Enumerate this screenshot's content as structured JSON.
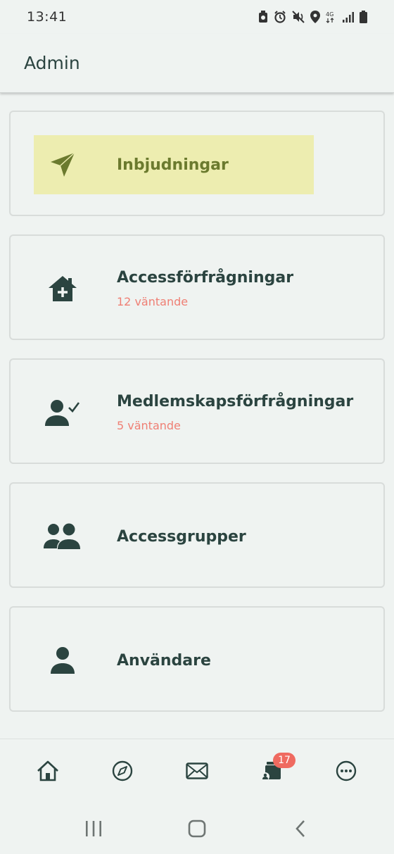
{
  "status_bar": {
    "time": "13:41",
    "network": "4G"
  },
  "app_bar": {
    "title": "Admin"
  },
  "cards": [
    {
      "title": "Inbjudningar",
      "subtitle": "",
      "icon": "send-icon",
      "highlighted": true
    },
    {
      "title": "Accessförfrågningar",
      "subtitle": "12 väntande",
      "icon": "house-plus-icon",
      "highlighted": false
    },
    {
      "title": "Medlemskapsförfrågningar",
      "subtitle": "5 väntande",
      "icon": "user-check-icon",
      "highlighted": false
    },
    {
      "title": "Accessgrupper",
      "subtitle": "",
      "icon": "users-icon",
      "highlighted": false
    },
    {
      "title": "Användare",
      "subtitle": "",
      "icon": "user-icon",
      "highlighted": false
    }
  ],
  "bottom_nav": {
    "items": [
      "home-icon",
      "compass-icon",
      "mail-icon",
      "cards-icon",
      "more-icon"
    ],
    "badge": "17"
  },
  "system_nav": [
    "recents-icon",
    "home-button-icon",
    "back-icon"
  ],
  "colors": {
    "background": "#eff3f1",
    "text": "#2b4440",
    "accent_pending": "#ef7f74",
    "highlight": "#ededb0",
    "badge": "#ef6a60"
  }
}
